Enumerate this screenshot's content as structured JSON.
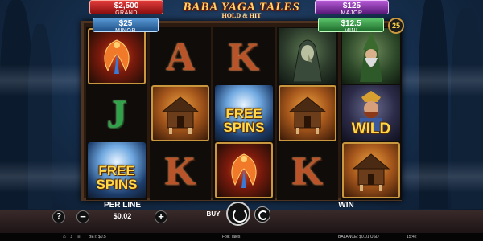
{
  "game": {
    "logo_title": "BABA YAGA TALES",
    "logo_subtitle": "HOLD & HIT",
    "lines_count": "25"
  },
  "jackpots": {
    "grand": {
      "amount": "$2,500",
      "label": "GRAND",
      "color": "#c21f1f"
    },
    "minor": {
      "amount": "$25",
      "label": "MINOR",
      "color": "#2f6eae"
    },
    "major": {
      "amount": "$125",
      "label": "MAJOR",
      "color": "#8a2fae"
    },
    "mini": {
      "amount": "$12.5",
      "label": "MINI",
      "color": "#2f9a40"
    }
  },
  "reels": [
    [
      {
        "symbol": "phoenix-bird"
      },
      {
        "symbol": "J"
      },
      {
        "symbol": "free-spins",
        "text": "FREE SPINS"
      }
    ],
    [
      {
        "symbol": "A"
      },
      {
        "symbol": "hut"
      },
      {
        "symbol": "K"
      }
    ],
    [
      {
        "symbol": "K"
      },
      {
        "symbol": "free-spins",
        "text": "FREE SPINS"
      },
      {
        "symbol": "phoenix-bird"
      }
    ],
    [
      {
        "symbol": "witch"
      },
      {
        "symbol": "hut"
      },
      {
        "symbol": "K"
      }
    ],
    [
      {
        "symbol": "wizard"
      },
      {
        "symbol": "wild-dwarf",
        "text": "WILD"
      },
      {
        "symbol": "hut"
      }
    ]
  ],
  "controls": {
    "help_label": "?",
    "minus_label": "−",
    "plus_label": "+",
    "per_line_label": "PER LINE",
    "per_line_value": "$0.02",
    "buy_label": "BUY",
    "win_label": "WIN"
  },
  "status_bar": {
    "bet": "BET: $0.5",
    "game_name": "Folk Tales",
    "balance": "BALANCE: $0.01",
    "currency": "USD",
    "time": "15:42"
  }
}
